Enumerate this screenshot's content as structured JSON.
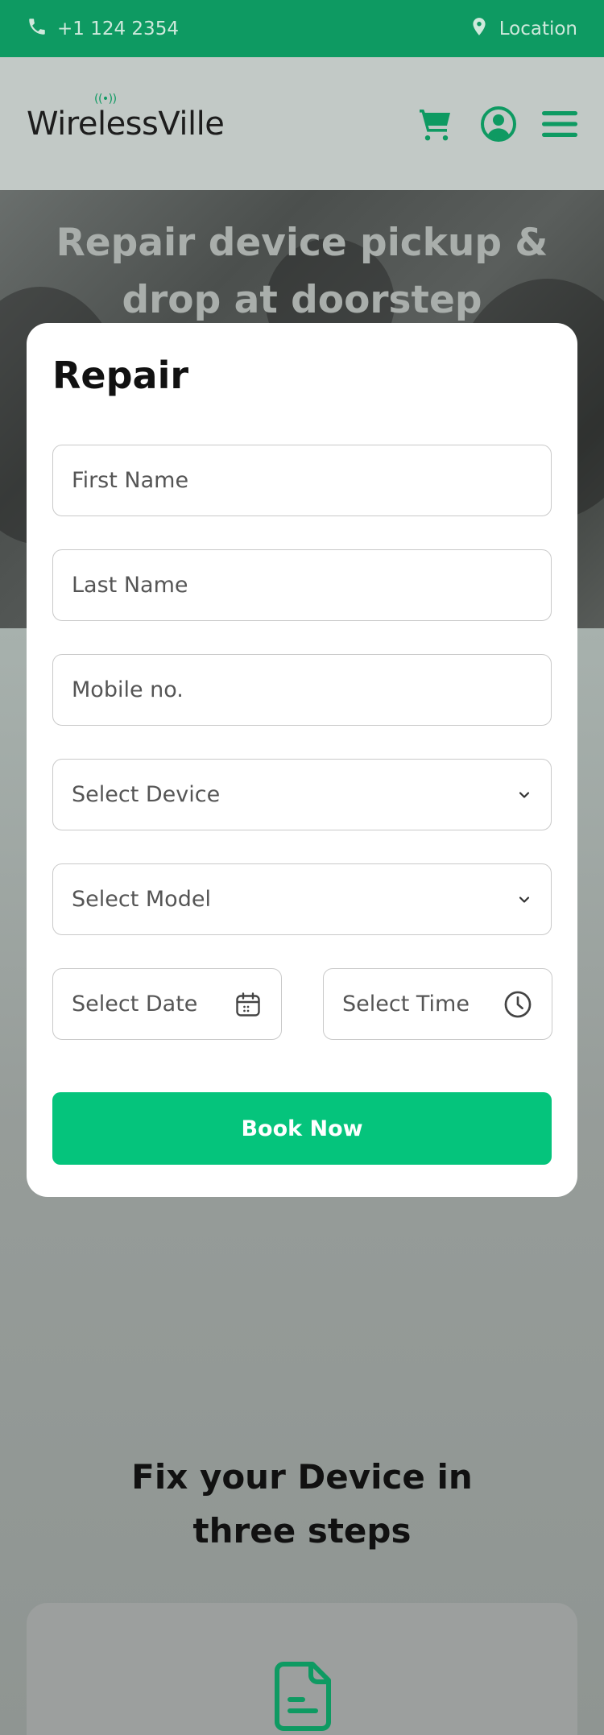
{
  "topbar": {
    "phone": "+1 124 2354",
    "location": "Location"
  },
  "header": {
    "logo": "WirelessVille",
    "icons": [
      "cart-icon",
      "user-icon",
      "menu-icon"
    ]
  },
  "hero": {
    "title": "Repair device pickup & drop at doorstep"
  },
  "form": {
    "title": "Repair",
    "first_name_placeholder": "First Name",
    "last_name_placeholder": "Last Name",
    "mobile_placeholder": "Mobile no.",
    "device_select": "Select Device",
    "model_select": "Select Model",
    "date_placeholder": "Select Date",
    "time_placeholder": "Select Time",
    "submit_label": "Book Now"
  },
  "steps": {
    "title": "Fix your Device in three steps"
  },
  "colors": {
    "brand_green": "#0e9a62",
    "button_green": "#05c47c"
  }
}
